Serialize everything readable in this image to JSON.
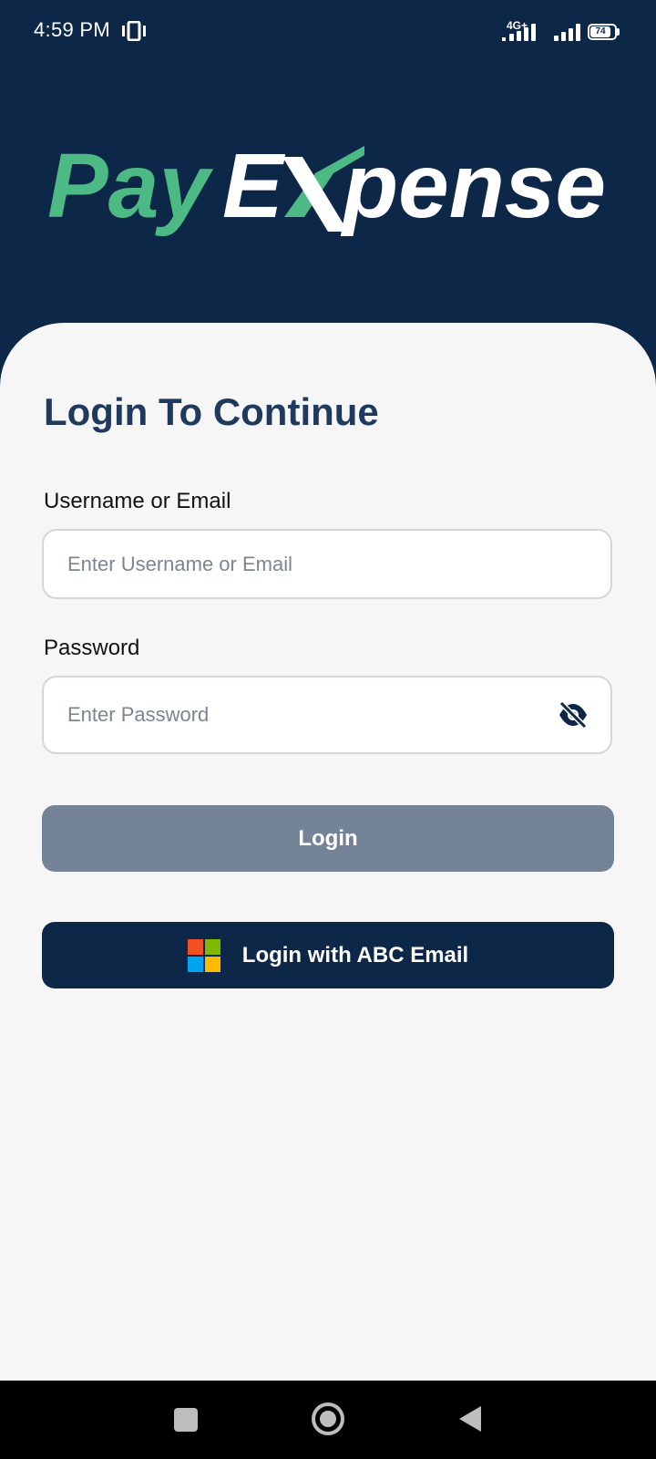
{
  "status_bar": {
    "time": "4:59 PM",
    "network_type": "4G+",
    "battery_level": "74",
    "icons": [
      "vibrate-icon",
      "signal-4g-icon",
      "signal-icon",
      "battery-icon"
    ]
  },
  "logo": {
    "part1": "Pay",
    "part2": "E",
    "part3": "X",
    "part4": "pense",
    "green_color": "#4dba86",
    "white_color": "#ffffff"
  },
  "form": {
    "title": "Login To Continue",
    "username_label": "Username or Email",
    "username_placeholder": "Enter Username or Email",
    "username_value": "",
    "password_label": "Password",
    "password_placeholder": "Enter Password",
    "password_value": "",
    "password_toggle_icon": "eye-off-icon"
  },
  "buttons": {
    "login_label": "Login",
    "sso_label": "Login with ABC Email",
    "sso_icon": "microsoft-icon"
  },
  "colors": {
    "header_bg": "#0d2748",
    "card_bg": "#f6f6f6",
    "title_color": "#1f3a5c",
    "login_disabled_bg": "#748398",
    "sso_bg": "#0d2748",
    "ms_red": "#f25022",
    "ms_green": "#7fba00",
    "ms_blue": "#00a4ef",
    "ms_yellow": "#ffb900"
  },
  "nav_bar": {
    "icons": [
      "recents-icon",
      "home-icon",
      "back-icon"
    ]
  }
}
